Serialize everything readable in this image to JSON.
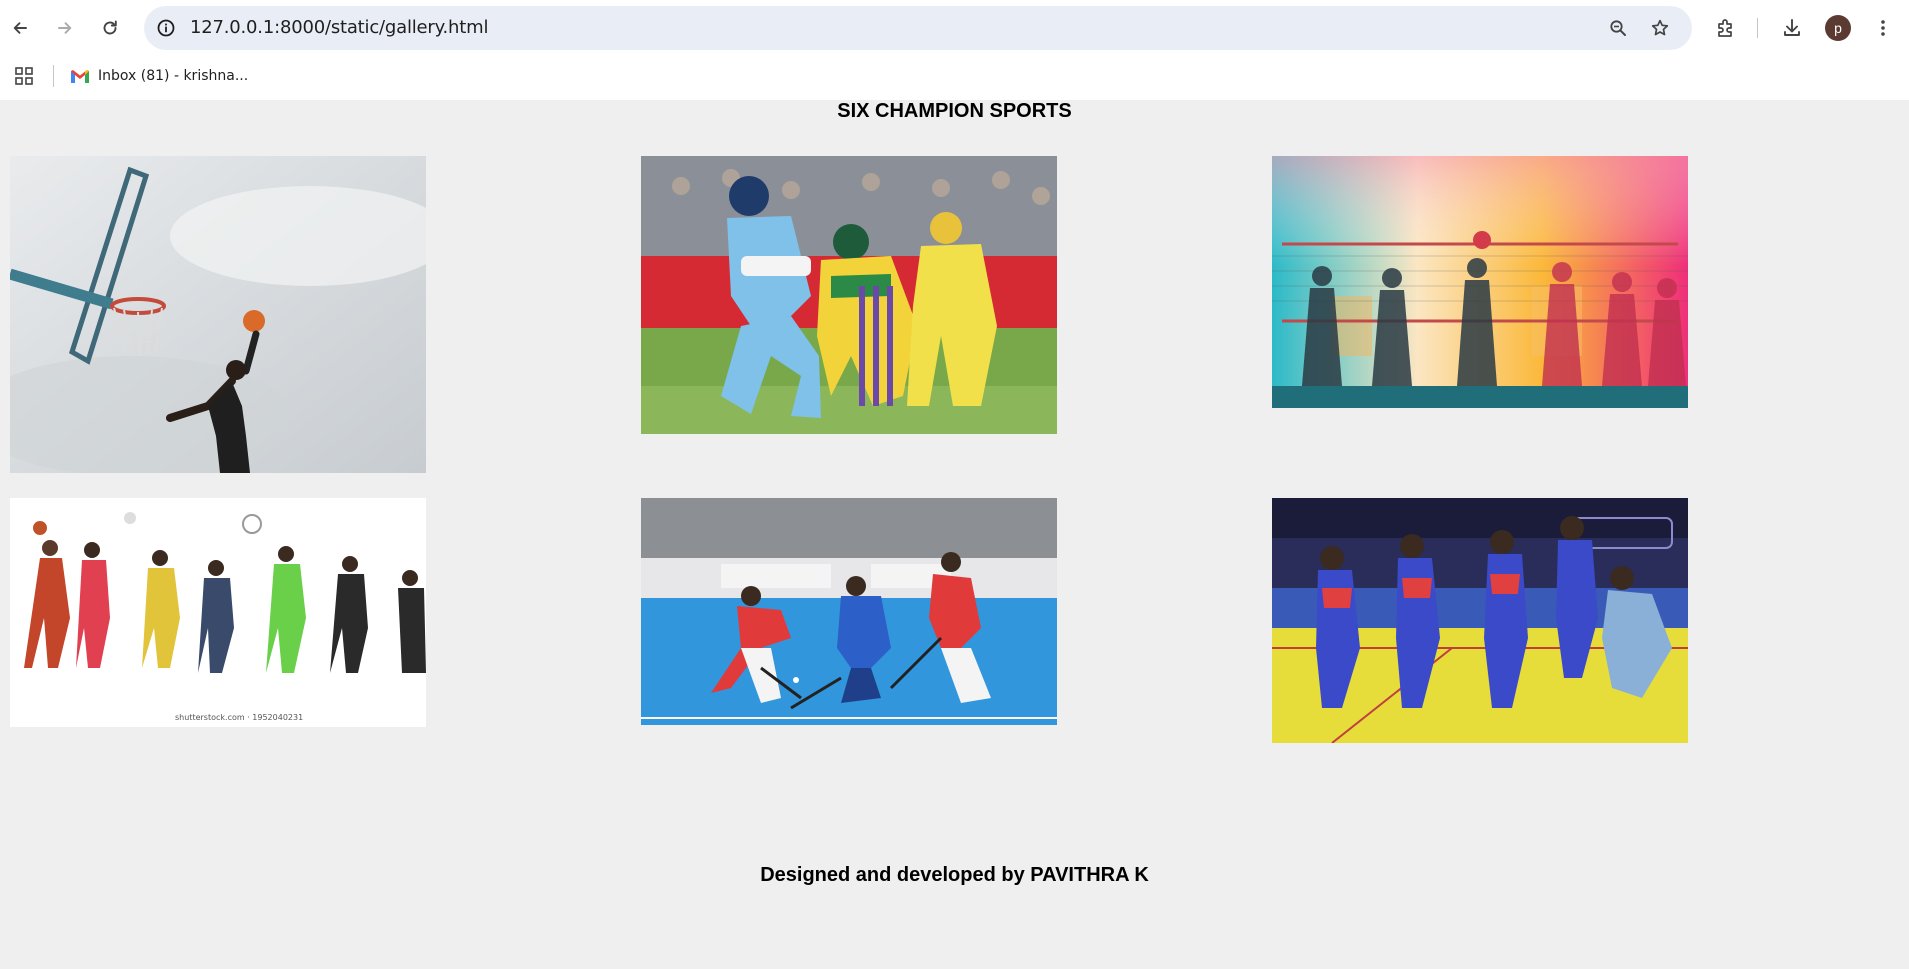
{
  "browser": {
    "url": "127.0.0.1:8000/static/gallery.html",
    "profile_initial": "p",
    "bookmarks": [
      {
        "label": "Inbox (81) - krishna...",
        "icon": "gmail-icon"
      }
    ]
  },
  "page": {
    "title": "SIX CHAMPION SPORTS",
    "footer": "Designed and developed by PAVITHRA K",
    "watermark": "shutterstock.com · 1952040231",
    "gallery": [
      {
        "sport": "basketball",
        "icon": "basketball-image"
      },
      {
        "sport": "cricket",
        "icon": "cricket-image"
      },
      {
        "sport": "volleyball",
        "icon": "volleyball-image"
      },
      {
        "sport": "multi-sport",
        "icon": "multi-sport-image"
      },
      {
        "sport": "hockey",
        "icon": "hockey-image"
      },
      {
        "sport": "kabaddi",
        "icon": "kabaddi-image"
      }
    ]
  },
  "colors": {
    "page_bg": "#efefef",
    "omnibox_bg": "#e9eef6",
    "avatar_bg": "#5b3a32"
  }
}
